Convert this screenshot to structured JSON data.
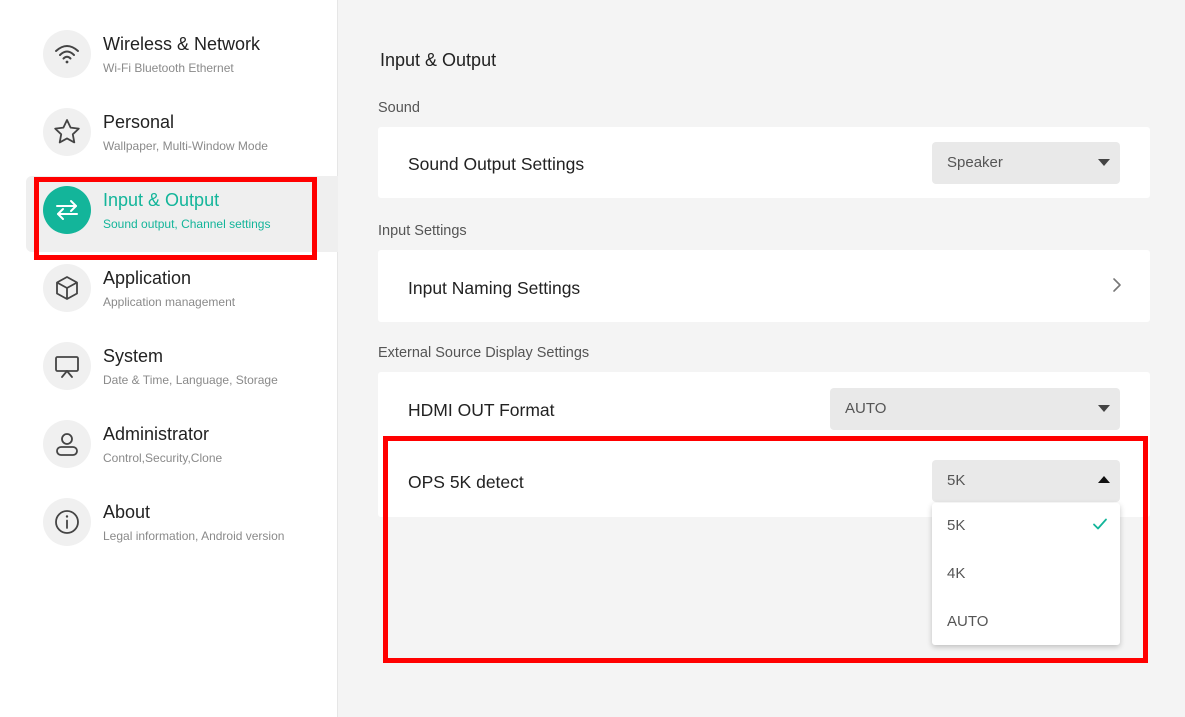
{
  "sidebar": {
    "items": [
      {
        "title": "Wireless & Network",
        "subtitle": "Wi-Fi Bluetooth Ethernet",
        "icon": "wifi-icon"
      },
      {
        "title": "Personal",
        "subtitle": "Wallpaper, Multi-Window Mode",
        "icon": "star-icon"
      },
      {
        "title": "Input & Output",
        "subtitle": "Sound output, Channel settings",
        "icon": "swap-arrows-icon",
        "active": true
      },
      {
        "title": "Application",
        "subtitle": "Application management",
        "icon": "cube-icon"
      },
      {
        "title": "System",
        "subtitle": "Date & Time, Language, Storage",
        "icon": "display-stand-icon"
      },
      {
        "title": "Administrator",
        "subtitle": "Control,Security,Clone",
        "icon": "user-icon"
      },
      {
        "title": "About",
        "subtitle": "Legal information, Android version",
        "icon": "info-icon"
      }
    ]
  },
  "main": {
    "title": "Input & Output",
    "sections": [
      {
        "label": "Sound",
        "rows": [
          {
            "label": "Sound Output Settings",
            "value": "Speaker"
          }
        ]
      },
      {
        "label": "Input Settings",
        "rows": [
          {
            "label": "Input Naming Settings"
          }
        ]
      },
      {
        "label": "External Source Display Settings",
        "rows": [
          {
            "label": "HDMI OUT Format",
            "value": "AUTO"
          },
          {
            "label": "OPS 5K detect",
            "value": "5K"
          }
        ]
      }
    ]
  },
  "dropdown": {
    "options": [
      "5K",
      "4K",
      "AUTO"
    ],
    "selected": "5K"
  },
  "colors": {
    "accent": "#13b59a",
    "highlight": "#ff0000",
    "background": "#f4f4f4"
  }
}
